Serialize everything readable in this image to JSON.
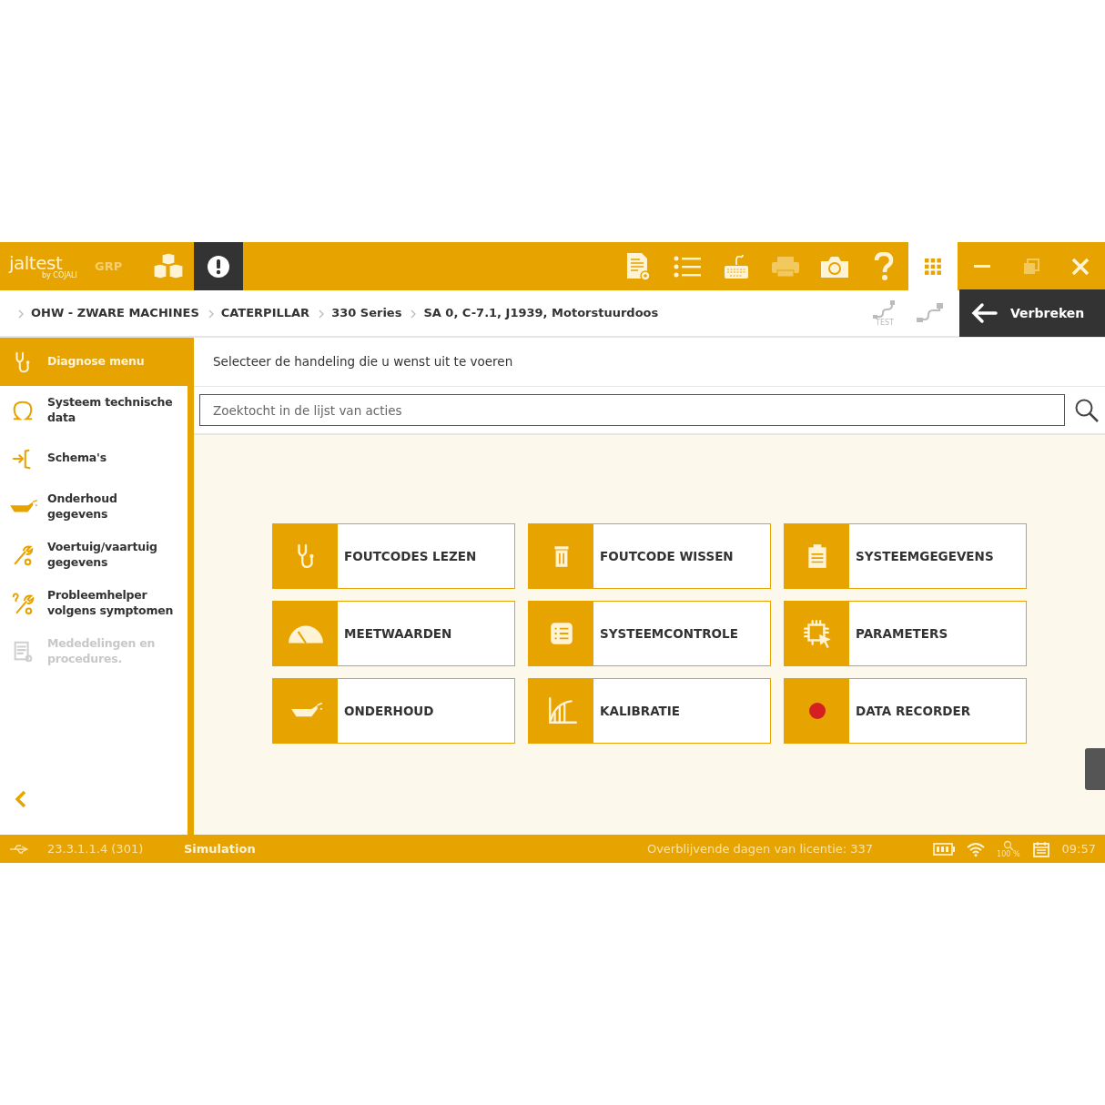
{
  "header": {
    "logo": {
      "name": "jaltest",
      "byline": "by COJALI"
    },
    "product": "GRP",
    "tools": [
      {
        "kind": "report",
        "disabled": false
      },
      {
        "kind": "list",
        "disabled": false
      },
      {
        "kind": "keyboard",
        "disabled": false
      },
      {
        "kind": "printer",
        "disabled": true
      },
      {
        "kind": "camera",
        "disabled": false
      },
      {
        "kind": "help",
        "disabled": false
      }
    ],
    "window_controls": [
      {
        "kind": "minimize",
        "disabled": false
      },
      {
        "kind": "restore",
        "disabled": true
      },
      {
        "kind": "close",
        "disabled": false
      }
    ]
  },
  "breadcrumbs": [
    "OHW - ZWARE MACHINES",
    "CATERPILLAR",
    "330 Series",
    "SA 0, C-7.1, J1939, Motorstuurdoos"
  ],
  "connection": {
    "test_label": "TEST",
    "disconnect": "Verbreken"
  },
  "sidebar": {
    "items": [
      {
        "kind": "stethoscope",
        "label": "Diagnose menu",
        "selected": true,
        "disabled": false
      },
      {
        "kind": "omega",
        "label": "Systeem technische data",
        "selected": false,
        "disabled": false
      },
      {
        "kind": "schema",
        "label": "Schema's",
        "selected": false,
        "disabled": false
      },
      {
        "kind": "oilcan",
        "label": "Onderhoud gegevens",
        "selected": false,
        "disabled": false
      },
      {
        "kind": "wrench",
        "label": "Voertuig/vaartuig gegevens",
        "selected": false,
        "disabled": false
      },
      {
        "kind": "wrench-question",
        "label": "Probleemhelper volgens symptomen",
        "selected": false,
        "disabled": false
      },
      {
        "kind": "document",
        "label": "Mededelingen en procedures.",
        "selected": false,
        "disabled": true
      }
    ]
  },
  "prompt": "Selecteer de handeling die u wenst uit te voeren",
  "search": {
    "placeholder": "Zoektocht in de lijst van acties"
  },
  "actions": [
    {
      "kind": "stethoscope",
      "label": "FOUTCODES LEZEN"
    },
    {
      "kind": "trash",
      "label": "FOUTCODE WISSEN"
    },
    {
      "kind": "clipboard",
      "label": "SYSTEEMGEGEVENS"
    },
    {
      "kind": "gauge",
      "label": "MEETWAARDEN"
    },
    {
      "kind": "checklist",
      "label": "SYSTEEMCONTROLE"
    },
    {
      "kind": "chip",
      "label": "PARAMETERS"
    },
    {
      "kind": "oilcan",
      "label": "ONDERHOUD"
    },
    {
      "kind": "curve",
      "label": "KALIBRATIE"
    },
    {
      "kind": "record",
      "label": "DATA RECORDER"
    }
  ],
  "status_bar": {
    "version": "23.3.1.1.4 (301)",
    "mode": "Simulation",
    "license": "Overblijvende dagen van licentie: 337",
    "zoom": "100 %",
    "time": "09:57"
  }
}
